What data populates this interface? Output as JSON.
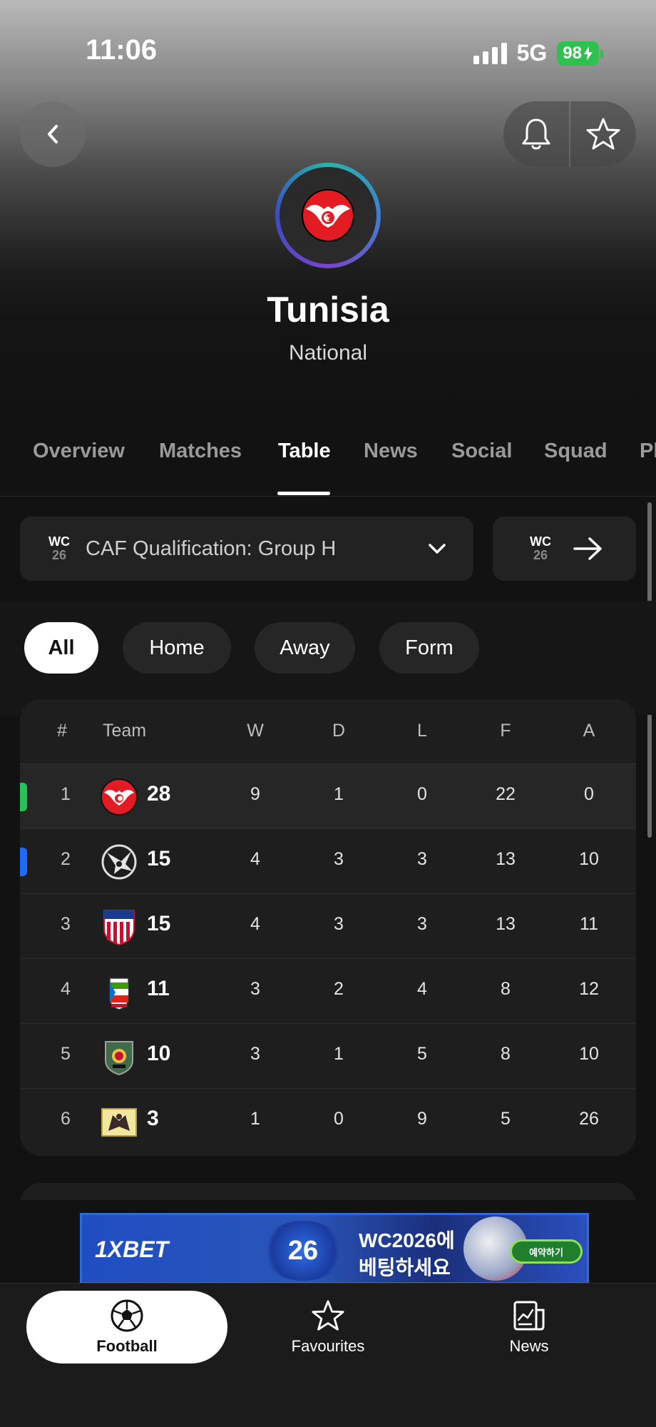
{
  "status_bar": {
    "time": "11:06",
    "network": "5G",
    "battery": "98"
  },
  "header": {
    "back_icon": "chevron-left-icon",
    "notification_icon": "bell-icon",
    "favourite_icon": "star-icon",
    "team_name": "Tunisia",
    "team_type": "National"
  },
  "tabs": [
    {
      "label": "Overview",
      "active": false
    },
    {
      "label": "Matches",
      "active": false
    },
    {
      "label": "Table",
      "active": true
    },
    {
      "label": "News",
      "active": false
    },
    {
      "label": "Social",
      "active": false
    },
    {
      "label": "Squad",
      "active": false
    },
    {
      "label": "Pl",
      "active": false
    }
  ],
  "league": {
    "badge_top": "WC",
    "badge_num": "26",
    "name": "CAF Qualification: Group H"
  },
  "filters": [
    {
      "label": "All",
      "active": true
    },
    {
      "label": "Home",
      "active": false
    },
    {
      "label": "Away",
      "active": false
    },
    {
      "label": "Form",
      "active": false
    }
  ],
  "table": {
    "headers": {
      "pos": "#",
      "team": "Team",
      "w": "W",
      "d": "D",
      "l": "L",
      "f": "F",
      "a": "A"
    },
    "rows": [
      {
        "pos": "1",
        "pts": "28",
        "w": "9",
        "d": "1",
        "l": "0",
        "f": "22",
        "a": "0",
        "marker": "#27c25a",
        "highlight": true
      },
      {
        "pos": "2",
        "pts": "15",
        "w": "4",
        "d": "3",
        "l": "3",
        "f": "13",
        "a": "10",
        "marker": "#1f6bff",
        "highlight": false
      },
      {
        "pos": "3",
        "pts": "15",
        "w": "4",
        "d": "3",
        "l": "3",
        "f": "13",
        "a": "11",
        "marker": "",
        "highlight": false
      },
      {
        "pos": "4",
        "pts": "11",
        "w": "3",
        "d": "2",
        "l": "4",
        "f": "8",
        "a": "12",
        "marker": "",
        "highlight": false
      },
      {
        "pos": "5",
        "pts": "10",
        "w": "3",
        "d": "1",
        "l": "5",
        "f": "8",
        "a": "10",
        "marker": "",
        "highlight": false
      },
      {
        "pos": "6",
        "pts": "3",
        "w": "1",
        "d": "0",
        "l": "9",
        "f": "5",
        "a": "26",
        "marker": "",
        "highlight": false
      }
    ]
  },
  "ad": {
    "brand": "1XBET",
    "center": "26",
    "line1": "WC2026에",
    "line2": "베팅하세요",
    "cta": "예약하기"
  },
  "bottom_nav": [
    {
      "label": "Football",
      "icon": "football-icon",
      "active": true
    },
    {
      "label": "Favourites",
      "icon": "star-icon",
      "active": false
    },
    {
      "label": "News",
      "icon": "news-icon",
      "active": false
    }
  ]
}
